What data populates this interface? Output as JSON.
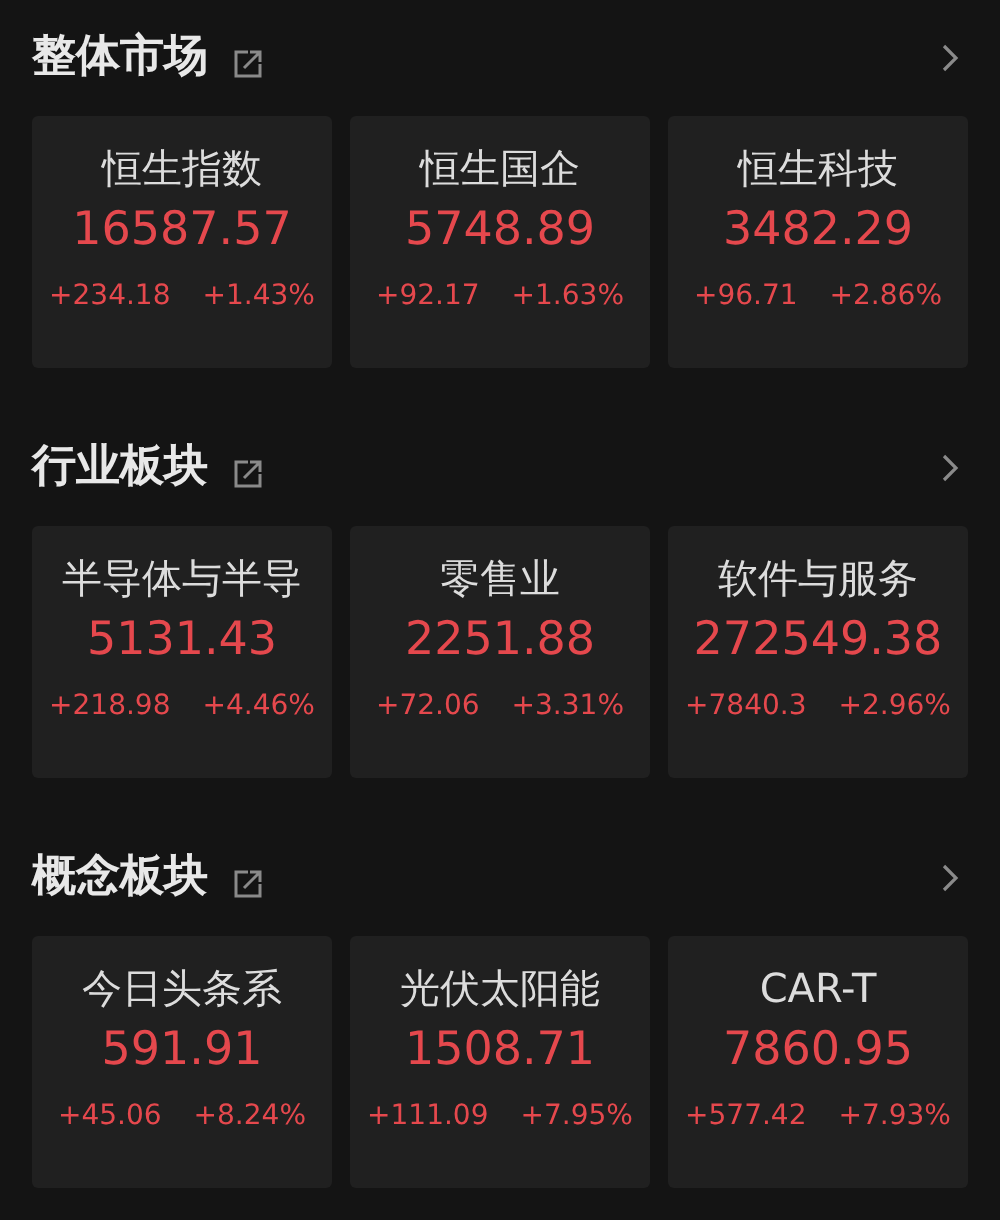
{
  "sections": [
    {
      "title": "整体市场",
      "cards": [
        {
          "name": "恒生指数",
          "value": "16587.57",
          "change": "+234.18",
          "percent": "+1.43%"
        },
        {
          "name": "恒生国企",
          "value": "5748.89",
          "change": "+92.17",
          "percent": "+1.63%"
        },
        {
          "name": "恒生科技",
          "value": "3482.29",
          "change": "+96.71",
          "percent": "+2.86%"
        }
      ]
    },
    {
      "title": "行业板块",
      "cards": [
        {
          "name": "半导体与半导",
          "value": "5131.43",
          "change": "+218.98",
          "percent": "+4.46%"
        },
        {
          "name": "零售业",
          "value": "2251.88",
          "change": "+72.06",
          "percent": "+3.31%"
        },
        {
          "name": "软件与服务",
          "value": "272549.38",
          "change": "+7840.3",
          "percent": "+2.96%"
        }
      ]
    },
    {
      "title": "概念板块",
      "cards": [
        {
          "name": "今日头条系",
          "value": "591.91",
          "change": "+45.06",
          "percent": "+8.24%"
        },
        {
          "name": "光伏太阳能",
          "value": "1508.71",
          "change": "+111.09",
          "percent": "+7.95%"
        },
        {
          "name": "CAR-T",
          "value": "7860.95",
          "change": "+577.42",
          "percent": "+7.93%"
        }
      ]
    }
  ]
}
